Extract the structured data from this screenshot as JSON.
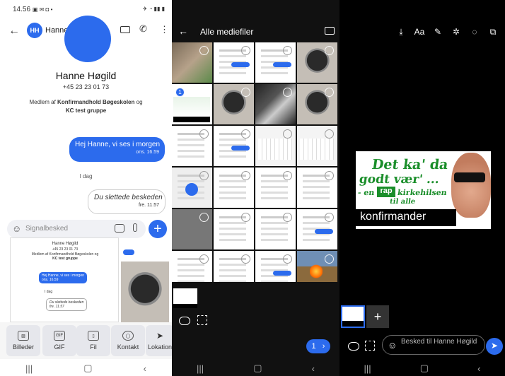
{
  "panel1": {
    "status": {
      "time": "14.56",
      "left_icons": "▣ ✉ ◘ •",
      "right_icons": "✈ ◔ ▮▮ ▮"
    },
    "contact": {
      "initials": "HH",
      "name": "Hanne Høgild",
      "name_badge": "@",
      "phone": "+45 23 23 01 73"
    },
    "member_text_prefix": "Medlem af ",
    "member_group_a": "Konfirmandhold Bøgeskolen",
    "member_text_and": " og",
    "member_group_b": "KC test gruppe",
    "messages": {
      "out_text": "Hej Hanne, vi ses i morgen",
      "out_time": "ons. 16.59",
      "day_divider": "I dag",
      "deleted_text": "Du slettede beskeden",
      "deleted_time": "fre. 11.57"
    },
    "composer": {
      "placeholder": "Signalbesked",
      "send": "+"
    },
    "preview": {
      "name": "Hanne Høgild",
      "phone": "+45 23 23 01 73",
      "member": "Medlem af Konfirmandhold Bøgeskolen og",
      "group": "KC test gruppe",
      "out": "Hej Hanne, vi ses i morgen",
      "out_time": "ons. 16.59",
      "day": "I dag",
      "deleted": "Du slettede beskeden",
      "deleted_time": "fre. 11.57"
    },
    "attach": [
      {
        "label": "Billeder",
        "icon": "gallery-icon",
        "glyph": "▨"
      },
      {
        "label": "GIF",
        "icon": "gif-icon",
        "glyph": "GIF"
      },
      {
        "label": "Fil",
        "icon": "file-icon",
        "glyph": "▯"
      },
      {
        "label": "Kontakt",
        "icon": "contact-icon",
        "glyph": "◯"
      },
      {
        "label": "Lokation",
        "icon": "location-icon",
        "glyph": "➤"
      }
    ],
    "nav": {
      "recents": "|||",
      "home": "▢",
      "back": "‹"
    }
  },
  "panel2": {
    "title": "Alle mediefiler",
    "selected_count": "1",
    "pill_count": "1",
    "pill_arrow": "›"
  },
  "sticker": {
    "line1": "Det ka' da",
    "line2": "godt vær' ...",
    "line3_prefix": "- en",
    "rap": "rap",
    "line3_suffix": "kirkehilsen",
    "line4": "til alle",
    "banner": "konfirmander"
  },
  "panel3": {
    "tools": [
      "⤓",
      "Aa",
      "✎",
      "✲",
      "◌",
      "⧉"
    ],
    "add": "+",
    "input_placeholder": "Besked til Hanne Høgild"
  },
  "colors": {
    "signal_blue": "#2c6bed",
    "sticker_green": "#1a8e2a"
  }
}
